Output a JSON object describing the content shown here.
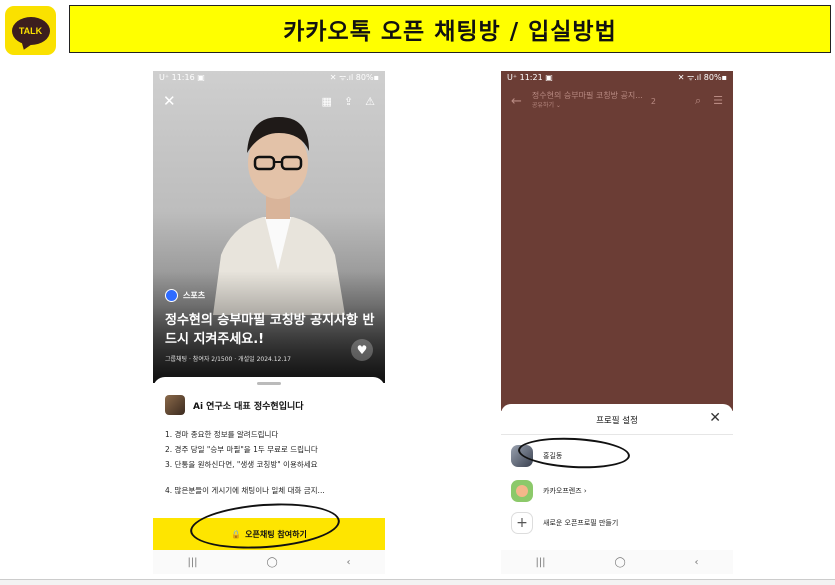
{
  "logo": {
    "text": "TALK"
  },
  "title": "카카오톡 오픈 채팅방 / 입실방법",
  "phone1": {
    "status_time": "U⁺ 11:16 ▣",
    "status_right": "✕ ᯤ.ıl 80%▪",
    "category": "스포츠",
    "room_title": "정수현의 승부마필 코칭방 공지사항 반드시 지켜주세요.!",
    "room_meta": "그룹채팅 · 참여자 2/1500 · 개설일 2024.12.17",
    "host_name": "Ai 연구소 대표 정수현입니다",
    "notice": [
      "1. 경마 종요한 정보를 알려드립니다",
      "2. 경주 당일 \"승부 마필\"을 1두 무료로 드립니다",
      "3. 단통을 원하신다면, \"생생 코칭방\" 이용하세요",
      "4. 많은분들이 게시기에 채팅이나 일체 대화 금지..."
    ],
    "join_button": "오픈채팅 참여하기",
    "nav": [
      "|||",
      "◯",
      "‹"
    ]
  },
  "phone2": {
    "status_time": "U⁺ 11:21 ▣",
    "status_right": "✕ ᯤ.ıl 80%▪",
    "chat_title": "정수현의 승부마필 코칭방 공지...",
    "chat_subtitle": "공유하기 ⌄",
    "member_count": "2",
    "modal_title": "프로필 설정",
    "profiles": [
      {
        "label": "홍길동"
      },
      {
        "label": "카카오프렌즈 ›"
      },
      {
        "label": "새로운 오픈프로필 만들기"
      }
    ],
    "nav": [
      "|||",
      "◯",
      "‹"
    ]
  },
  "colors": {
    "kakao_yellow": "#fee500",
    "title_bg": "#ffff00",
    "chat_bg": "#6b3d35"
  }
}
